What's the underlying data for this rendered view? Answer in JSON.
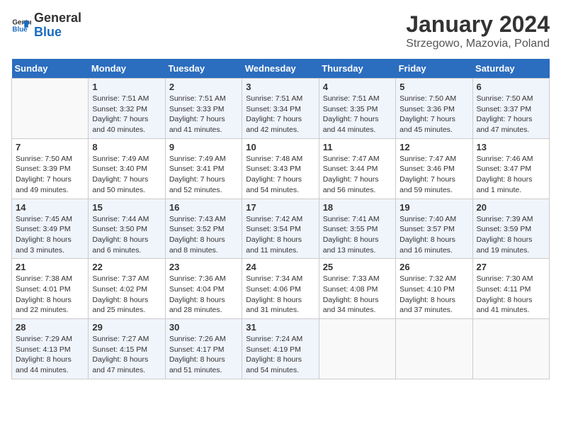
{
  "logo": {
    "line1": "General",
    "line2": "Blue"
  },
  "title": "January 2024",
  "subtitle": "Strzegowo, Mazovia, Poland",
  "days_header": [
    "Sunday",
    "Monday",
    "Tuesday",
    "Wednesday",
    "Thursday",
    "Friday",
    "Saturday"
  ],
  "weeks": [
    [
      {
        "num": "",
        "info": ""
      },
      {
        "num": "1",
        "info": "Sunrise: 7:51 AM\nSunset: 3:32 PM\nDaylight: 7 hours\nand 40 minutes."
      },
      {
        "num": "2",
        "info": "Sunrise: 7:51 AM\nSunset: 3:33 PM\nDaylight: 7 hours\nand 41 minutes."
      },
      {
        "num": "3",
        "info": "Sunrise: 7:51 AM\nSunset: 3:34 PM\nDaylight: 7 hours\nand 42 minutes."
      },
      {
        "num": "4",
        "info": "Sunrise: 7:51 AM\nSunset: 3:35 PM\nDaylight: 7 hours\nand 44 minutes."
      },
      {
        "num": "5",
        "info": "Sunrise: 7:50 AM\nSunset: 3:36 PM\nDaylight: 7 hours\nand 45 minutes."
      },
      {
        "num": "6",
        "info": "Sunrise: 7:50 AM\nSunset: 3:37 PM\nDaylight: 7 hours\nand 47 minutes."
      }
    ],
    [
      {
        "num": "7",
        "info": "Sunrise: 7:50 AM\nSunset: 3:39 PM\nDaylight: 7 hours\nand 49 minutes."
      },
      {
        "num": "8",
        "info": "Sunrise: 7:49 AM\nSunset: 3:40 PM\nDaylight: 7 hours\nand 50 minutes."
      },
      {
        "num": "9",
        "info": "Sunrise: 7:49 AM\nSunset: 3:41 PM\nDaylight: 7 hours\nand 52 minutes."
      },
      {
        "num": "10",
        "info": "Sunrise: 7:48 AM\nSunset: 3:43 PM\nDaylight: 7 hours\nand 54 minutes."
      },
      {
        "num": "11",
        "info": "Sunrise: 7:47 AM\nSunset: 3:44 PM\nDaylight: 7 hours\nand 56 minutes."
      },
      {
        "num": "12",
        "info": "Sunrise: 7:47 AM\nSunset: 3:46 PM\nDaylight: 7 hours\nand 59 minutes."
      },
      {
        "num": "13",
        "info": "Sunrise: 7:46 AM\nSunset: 3:47 PM\nDaylight: 8 hours\nand 1 minute."
      }
    ],
    [
      {
        "num": "14",
        "info": "Sunrise: 7:45 AM\nSunset: 3:49 PM\nDaylight: 8 hours\nand 3 minutes."
      },
      {
        "num": "15",
        "info": "Sunrise: 7:44 AM\nSunset: 3:50 PM\nDaylight: 8 hours\nand 6 minutes."
      },
      {
        "num": "16",
        "info": "Sunrise: 7:43 AM\nSunset: 3:52 PM\nDaylight: 8 hours\nand 8 minutes."
      },
      {
        "num": "17",
        "info": "Sunrise: 7:42 AM\nSunset: 3:54 PM\nDaylight: 8 hours\nand 11 minutes."
      },
      {
        "num": "18",
        "info": "Sunrise: 7:41 AM\nSunset: 3:55 PM\nDaylight: 8 hours\nand 13 minutes."
      },
      {
        "num": "19",
        "info": "Sunrise: 7:40 AM\nSunset: 3:57 PM\nDaylight: 8 hours\nand 16 minutes."
      },
      {
        "num": "20",
        "info": "Sunrise: 7:39 AM\nSunset: 3:59 PM\nDaylight: 8 hours\nand 19 minutes."
      }
    ],
    [
      {
        "num": "21",
        "info": "Sunrise: 7:38 AM\nSunset: 4:01 PM\nDaylight: 8 hours\nand 22 minutes."
      },
      {
        "num": "22",
        "info": "Sunrise: 7:37 AM\nSunset: 4:02 PM\nDaylight: 8 hours\nand 25 minutes."
      },
      {
        "num": "23",
        "info": "Sunrise: 7:36 AM\nSunset: 4:04 PM\nDaylight: 8 hours\nand 28 minutes."
      },
      {
        "num": "24",
        "info": "Sunrise: 7:34 AM\nSunset: 4:06 PM\nDaylight: 8 hours\nand 31 minutes."
      },
      {
        "num": "25",
        "info": "Sunrise: 7:33 AM\nSunset: 4:08 PM\nDaylight: 8 hours\nand 34 minutes."
      },
      {
        "num": "26",
        "info": "Sunrise: 7:32 AM\nSunset: 4:10 PM\nDaylight: 8 hours\nand 37 minutes."
      },
      {
        "num": "27",
        "info": "Sunrise: 7:30 AM\nSunset: 4:11 PM\nDaylight: 8 hours\nand 41 minutes."
      }
    ],
    [
      {
        "num": "28",
        "info": "Sunrise: 7:29 AM\nSunset: 4:13 PM\nDaylight: 8 hours\nand 44 minutes."
      },
      {
        "num": "29",
        "info": "Sunrise: 7:27 AM\nSunset: 4:15 PM\nDaylight: 8 hours\nand 47 minutes."
      },
      {
        "num": "30",
        "info": "Sunrise: 7:26 AM\nSunset: 4:17 PM\nDaylight: 8 hours\nand 51 minutes."
      },
      {
        "num": "31",
        "info": "Sunrise: 7:24 AM\nSunset: 4:19 PM\nDaylight: 8 hours\nand 54 minutes."
      },
      {
        "num": "",
        "info": ""
      },
      {
        "num": "",
        "info": ""
      },
      {
        "num": "",
        "info": ""
      }
    ]
  ]
}
